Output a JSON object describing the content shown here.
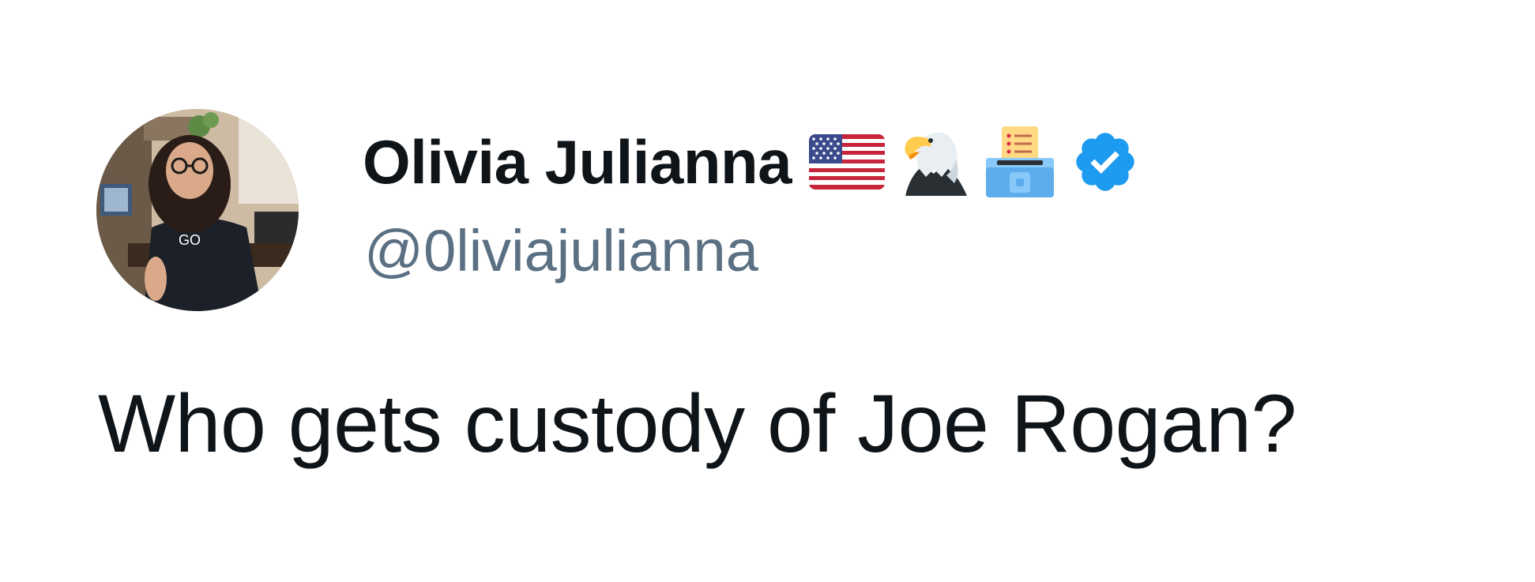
{
  "tweet": {
    "author": {
      "display_name": "Olivia Julianna",
      "handle": "@0liviajulianna",
      "name_emojis": [
        "us-flag-icon",
        "eagle-icon",
        "ballot-box-icon"
      ],
      "verified_icon": "verified-badge-icon",
      "verified_color": "#1d9bf0"
    },
    "text": "Who gets custody of Joe Rogan?"
  },
  "colors": {
    "text_primary": "#0f1419",
    "text_secondary": "#5b7083",
    "background": "#ffffff"
  }
}
